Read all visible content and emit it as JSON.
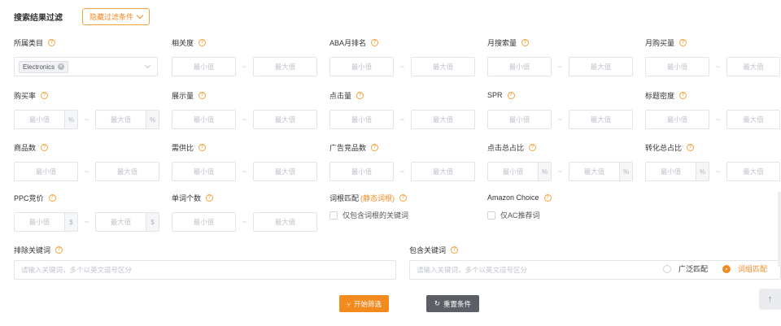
{
  "header": {
    "title": "搜索结果过滤",
    "toggle_label": "隐藏过滤条件"
  },
  "icons": {
    "help": "question-circle-icon",
    "toggle": "chevron-down-icon",
    "filter": "filter-icon",
    "reset": "refresh-icon",
    "back_top": "arrow-up-icon"
  },
  "placeholders": {
    "min": "最小值",
    "max": "最大值",
    "percent_suffix": "%",
    "dollar_suffix": "$",
    "range_separator": "~"
  },
  "fields": {
    "category": {
      "label": "所属类目",
      "tag": "Electronics"
    },
    "relevance": {
      "label": "相关度"
    },
    "aba_rank": {
      "label": "ABA月排名"
    },
    "monthly_search": {
      "label": "月搜索量"
    },
    "monthly_purchase": {
      "label": "月购买量"
    },
    "purchase_rate": {
      "label": "购买率"
    },
    "impressions": {
      "label": "展示量"
    },
    "clicks": {
      "label": "点击量"
    },
    "spr": {
      "label": "SPR"
    },
    "title_density": {
      "label": "标题密度"
    },
    "product_count": {
      "label": "商品数"
    },
    "supply_demand": {
      "label": "需供比"
    },
    "ad_competitors": {
      "label": "广告竞品数"
    },
    "click_share": {
      "label": "点击总占比"
    },
    "conversion_share": {
      "label": "转化总占比"
    },
    "ppc_bid": {
      "label": "PPC竞价"
    },
    "word_count": {
      "label": "单词个数"
    },
    "root_match": {
      "label": "词根匹配",
      "label_accent": "(静态词根)",
      "checkbox_label": "仅包含词根的关键词"
    },
    "amazon_choice": {
      "label": "Amazon Choice",
      "checkbox_label": "仅AC推荐词"
    },
    "exclude_keywords": {
      "label": "排除关键词",
      "placeholder": "请输入关键词，多个以英文逗号区分"
    },
    "include_keywords": {
      "label": "包含关键词",
      "placeholder": "请输入关键词，多个以英文逗号区分"
    }
  },
  "match_mode": {
    "options": [
      "广泛匹配",
      "词组匹配"
    ],
    "selected": "词组匹配"
  },
  "actions": {
    "start_label": "开始筛选",
    "reset_label": "重置条件"
  },
  "colors": {
    "accent": "#f08a24",
    "primary_button": "#f28a1e",
    "secondary_button": "#5c6066"
  }
}
